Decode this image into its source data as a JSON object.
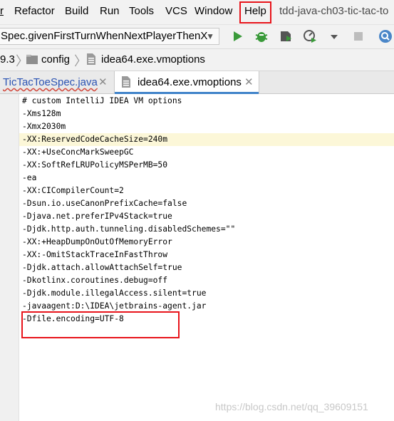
{
  "menu": {
    "items": [
      {
        "label": "Refactor"
      },
      {
        "label": "Build"
      },
      {
        "label": "Run"
      },
      {
        "label": "Tools"
      },
      {
        "label": "VCS"
      },
      {
        "label": "Window"
      },
      {
        "label": "Help"
      }
    ],
    "project_title": "tdd-java-ch03-tic-tac-to"
  },
  "run_toolbar": {
    "config_name": "Spec.givenFirstTurnWhenNextPlayerThenX",
    "icons": [
      "run-icon",
      "debug-icon",
      "coverage-icon",
      "profile-icon",
      "stop-icon",
      "search-icon"
    ]
  },
  "breadcrumb": {
    "items": [
      "9.3",
      "config",
      "idea64.exe.vmoptions"
    ]
  },
  "tabs": [
    {
      "label": "TicTacToeSpec.java",
      "active": false
    },
    {
      "label": "idea64.exe.vmoptions",
      "active": true
    }
  ],
  "editor": {
    "lines": [
      "# custom IntelliJ IDEA VM options",
      "-Xms128m",
      "-Xmx2030m",
      "-XX:ReservedCodeCacheSize=240m",
      "-XX:+UseConcMarkSweepGC",
      "-XX:SoftRefLRUPolicyMSPerMB=50",
      "-ea",
      "-XX:CICompilerCount=2",
      "-Dsun.io.useCanonPrefixCache=false",
      "-Djava.net.preferIPv4Stack=true",
      "-Djdk.http.auth.tunneling.disabledSchemes=\"\"",
      "-XX:+HeapDumpOnOutOfMemoryError",
      "-XX:-OmitStackTraceInFastThrow",
      "-Djdk.attach.allowAttachSelf=true",
      "-Dkotlinx.coroutines.debug=off",
      "-Djdk.module.illegalAccess.silent=true",
      "-javaagent:D:\\IDEA\\jetbrains-agent.jar",
      "-Dfile.encoding=UTF-8"
    ]
  },
  "watermark": "https://blog.csdn.net/qq_39609151",
  "colors": {
    "highlight": "#e8141b",
    "active_tab": "#4083c9",
    "link_tab": "#2b53b3",
    "run_green": "#3a9a3a"
  }
}
